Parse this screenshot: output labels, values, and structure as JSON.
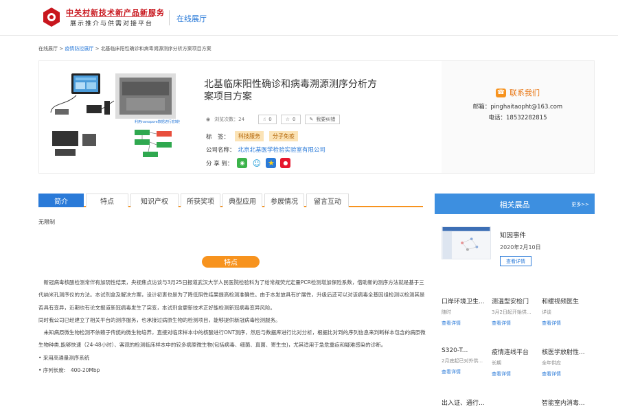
{
  "header": {
    "logo_title": "中关村新技术新产品新服务",
    "logo_subtitle": "展示推介与供需对接平台",
    "channel": "在线展厅"
  },
  "breadcrumb": {
    "home": "在线展厅",
    "sep1": ">",
    "section": "疫情防控展厅",
    "sep2": ">",
    "current": "北基临床阳性确诊和病毒溯源测序分析方案项目方案"
  },
  "product": {
    "title": "北基临床阳性确诊和病毒溯源测序分析方案项目方案",
    "views_label": "浏览次数：24",
    "likes": "0",
    "favorites": "0",
    "correction": "我要纠错",
    "tags_label": "标　签：",
    "tags": [
      "科技服务",
      "分子免疫"
    ],
    "company_label": "公司名称：",
    "company": "北京北基医学检验实验室有限公司",
    "share_label": "分 享 到："
  },
  "contact": {
    "title": "联系我们",
    "email": "邮箱：pinghaitaopht@163.com",
    "phone": "电话：18532282815"
  },
  "tabs": [
    "简介",
    "特点",
    "知识产权",
    "所获奖项",
    "典型应用",
    "参展情况",
    "留言互动"
  ],
  "intro_text": "无限制",
  "section_title": "特点",
  "body_paragraphs": [
    "新冠病毒核酸检测常伴有加阴性结果，央视焦点访谈与3月25日报道武汉大学人民医院检验科为了给常规荧光定量PCR检测增加保险系数，借助新的测序方法就是基于三代纳米孔测序仪的方法。本试剂盒及解决方案，设计初衷也是为了降低阴性结果提高检测准确性。由于本发放具有扩展性，升级后还可以对该病毒全基因组检测以检测其是否具有变异，近期也有论文报道新冠病毒发生了突变，本试剂盒更新技术正好能检测新冠病毒变异风险。",
    "同时我公司已经建立了相关平台的测序服务，也承接过病原生物的检测项目，能够提供新冠病毒检测服务。",
    "未知病原微生物检测不依赖于传统的微生物培养，直接对临床样本中的核酸进行ONT测序，然后与数据库进行比对分析，根据比对到的序列信息来判断样本包含的病原微生物种类,能够快速（24-48小时）、客观的检测临床样本中的较多病原微生物(包括病毒、细菌、真菌、寄生虫)，尤其适用于急危重症和疑难感染的诊断。",
    "• 采用高通量测序系统",
    "• 序列长度:　400-20Mbp"
  ],
  "sidebar": {
    "title": "相关展品",
    "more": "更多>>",
    "featured": {
      "title": "知因事件",
      "date": "2020年2月10日",
      "button": "查看详情"
    },
    "grid": [
      {
        "title": "口岸环境卫生...",
        "sub": "随时",
        "link": "查看详情"
      },
      {
        "title": "测温型安检门",
        "sub": "3月2日起开始供...",
        "link": "查看详情"
      },
      {
        "title": "和缓视频医生",
        "sub": "详谈",
        "link": "查看详情"
      },
      {
        "title": "S320-T...",
        "sub": "2月底起已对外供...",
        "link": "查看详情"
      },
      {
        "title": "疫情连线平台",
        "sub": "长期",
        "link": "查看详情"
      },
      {
        "title": "核医学放射性...",
        "sub": "全年供应",
        "link": "查看详情"
      },
      {
        "title": "出入证、通行...",
        "sub": "",
        "link": ""
      },
      {
        "title": "",
        "sub": "",
        "link": ""
      },
      {
        "title": "智能室内消毒...",
        "sub": "",
        "link": ""
      }
    ]
  },
  "colors": {
    "brand_red": "#c8161d",
    "link_blue": "#2a7ad8",
    "accent_orange": "#f7931e",
    "sidebar_blue": "#3d8fe0"
  }
}
